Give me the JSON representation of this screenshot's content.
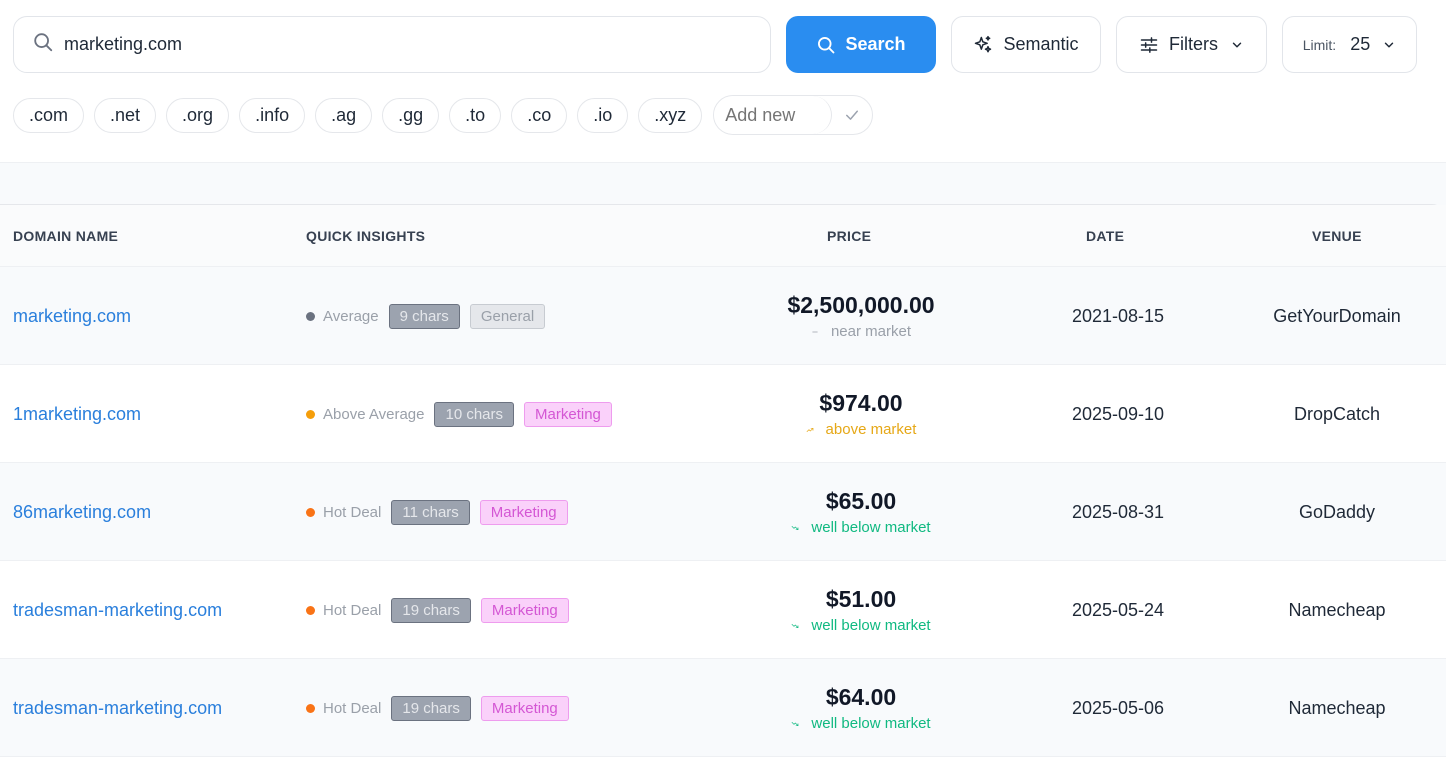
{
  "search": {
    "value": "marketing.com",
    "button_label": "Search"
  },
  "toolbar": {
    "semantic_label": "Semantic",
    "filters_label": "Filters",
    "limit_label": "Limit:",
    "limit_value": "25"
  },
  "tlds": [
    ".com",
    ".net",
    ".org",
    ".info",
    ".ag",
    ".gg",
    ".to",
    ".co",
    ".io",
    ".xyz"
  ],
  "add_new": {
    "placeholder": "Add new"
  },
  "table": {
    "headers": {
      "domain": "DOMAIN NAME",
      "insights": "QUICK INSIGHTS",
      "price": "PRICE",
      "date": "DATE",
      "venue": "VENUE"
    },
    "rows": [
      {
        "domain": "marketing.com",
        "rating": "Average",
        "rating_color": "#6b7280",
        "chars": "9 chars",
        "category": "General",
        "category_style": "general",
        "price": "$2,500,000.00",
        "note": "near market",
        "note_trend": "flat",
        "note_color": "#9aa0a9",
        "date": "2021-08-15",
        "venue": "GetYourDomain"
      },
      {
        "domain": "1marketing.com",
        "rating": "Above Average",
        "rating_color": "#f59e0b",
        "chars": "10 chars",
        "category": "Marketing",
        "category_style": "marketing",
        "price": "$974.00",
        "note": "above market",
        "note_trend": "up",
        "note_color": "#e6a817",
        "date": "2025-09-10",
        "venue": "DropCatch"
      },
      {
        "domain": "86marketing.com",
        "rating": "Hot Deal",
        "rating_color": "#f97316",
        "chars": "11 chars",
        "category": "Marketing",
        "category_style": "marketing",
        "price": "$65.00",
        "note": "well below market",
        "note_trend": "down",
        "note_color": "#10b981",
        "date": "2025-08-31",
        "venue": "GoDaddy"
      },
      {
        "domain": "tradesman-marketing.com",
        "rating": "Hot Deal",
        "rating_color": "#f97316",
        "chars": "19 chars",
        "category": "Marketing",
        "category_style": "marketing",
        "price": "$51.00",
        "note": "well below market",
        "note_trend": "down",
        "note_color": "#10b981",
        "date": "2025-05-24",
        "venue": "Namecheap"
      },
      {
        "domain": "tradesman-marketing.com",
        "rating": "Hot Deal",
        "rating_color": "#f97316",
        "chars": "19 chars",
        "category": "Marketing",
        "category_style": "marketing",
        "price": "$64.00",
        "note": "well below market",
        "note_trend": "down",
        "note_color": "#10b981",
        "date": "2025-05-06",
        "venue": "Namecheap"
      }
    ]
  }
}
